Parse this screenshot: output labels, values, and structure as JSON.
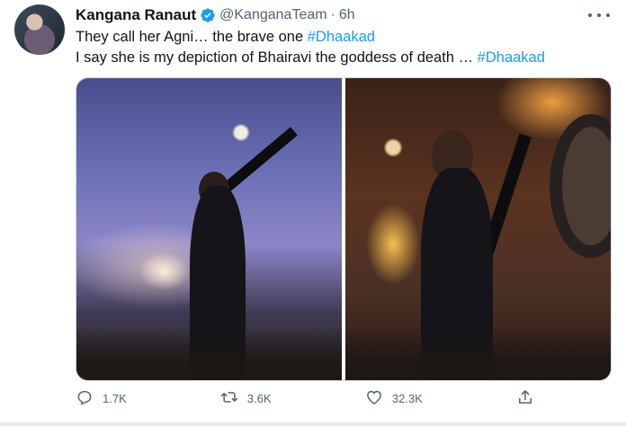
{
  "tweet": {
    "author_name": "Kangana Ranaut",
    "handle": "@KanganaTeam",
    "separator": "·",
    "time": "6h",
    "line1_text": "They call her Agni… the brave one ",
    "line1_hashtag": "#Dhaakad",
    "line2_text": "I say she is my depiction of Bhairavi the goddess of death … ",
    "line2_hashtag": "#Dhaakad"
  },
  "actions": {
    "reply_count": "1.7K",
    "retweet_count": "3.6K",
    "like_count": "32.3K"
  },
  "icons": {
    "verified": "verified-badge-icon",
    "more": "more-icon",
    "reply": "reply-icon",
    "retweet": "retweet-icon",
    "like": "heart-icon",
    "share": "share-icon"
  },
  "colors": {
    "text": "#0f1419",
    "secondary": "#536471",
    "accent": "#1d9bf0"
  }
}
